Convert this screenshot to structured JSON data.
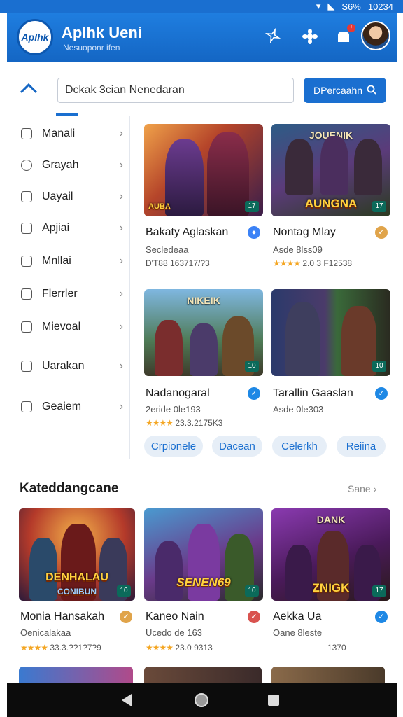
{
  "status_bar": {
    "battery": "S6%",
    "time": "10234",
    "icons": [
      "wifi-icon",
      "signal-icon"
    ]
  },
  "header": {
    "logo": "Aplhk",
    "title": "Aplhk Ueni",
    "subtitle": "Nesuoponr ifen",
    "icons": [
      "sparkle-icon",
      "gear-icon",
      "notification-bell-icon",
      "avatar"
    ]
  },
  "search": {
    "value": "Dckak 3cian Nenedaran",
    "button_label": "DPercaahn"
  },
  "sidebar": {
    "items": [
      {
        "label": "Manali"
      },
      {
        "label": "Grayah"
      },
      {
        "label": "Uayail"
      },
      {
        "label": "Apjiai"
      },
      {
        "label": "Mnllai"
      },
      {
        "label": "Flerrler"
      },
      {
        "label": "Mievoal"
      },
      {
        "label": "Uarakan"
      },
      {
        "label": "Geaiem"
      }
    ]
  },
  "grid_cards": [
    {
      "title": "Bakaty Aglaskan",
      "sub": "Secledeaa",
      "meta": "D'T88 163717/?3",
      "thumb_top": "",
      "thumb_text": "AUBA",
      "badge": "17",
      "verify_color": "#3b82f6"
    },
    {
      "title": "Nontag Mlay",
      "sub": "Asde 8lss09",
      "stars": "★★★★",
      "meta": "2.0 3 F12538",
      "thumb_top": "JOUENIK",
      "thumb_text": "AUNGNA",
      "badge": "17",
      "verify_color": "#e0a44a"
    },
    {
      "title": "Nadanogaral",
      "sub": "2eride 0le193",
      "stars": "★★★★",
      "meta": "23.3.2175K3",
      "thumb_top": "NIKEIK",
      "thumb_text": "",
      "badge": "10",
      "verify_color": "#1e88e5"
    },
    {
      "title": "Tarallin Gaaslan",
      "sub": "Asde 0le303",
      "meta": "",
      "thumb_top": "",
      "thumb_text": "",
      "badge": "10",
      "verify_color": "#1e88e5"
    }
  ],
  "chips": [
    "Crpionele",
    "Dacean",
    "Celerkh",
    "Reiina"
  ],
  "section": {
    "title": "Kateddangcane",
    "link": "Sane"
  },
  "bottom_cards": [
    {
      "title": "Monia Hansakah",
      "sub": "Oenicalakaa",
      "stars": "★★★★",
      "meta": "33.3.??1?7?9",
      "thumb_text": "DENHALAU",
      "thumb_text2": "CONIBUN",
      "badge": "10",
      "verify_color": "#e0a44a"
    },
    {
      "title": "Kaneo Nain",
      "sub": "Ucedo de 163",
      "stars": "★★★★",
      "meta": "23.0 9313",
      "thumb_text": "SENEN69",
      "badge": "10",
      "verify_color": "#d9534f"
    },
    {
      "title": "Aekka Ua",
      "sub": "Oane 8leste",
      "meta": "1370",
      "thumb_top": "DANK",
      "thumb_text": "ZNIGK",
      "badge": "17",
      "verify_color": "#1e88e5"
    }
  ],
  "colors": {
    "primary": "#1a6fd0",
    "header": "#1466c4",
    "chip_bg": "#e6eef7"
  }
}
